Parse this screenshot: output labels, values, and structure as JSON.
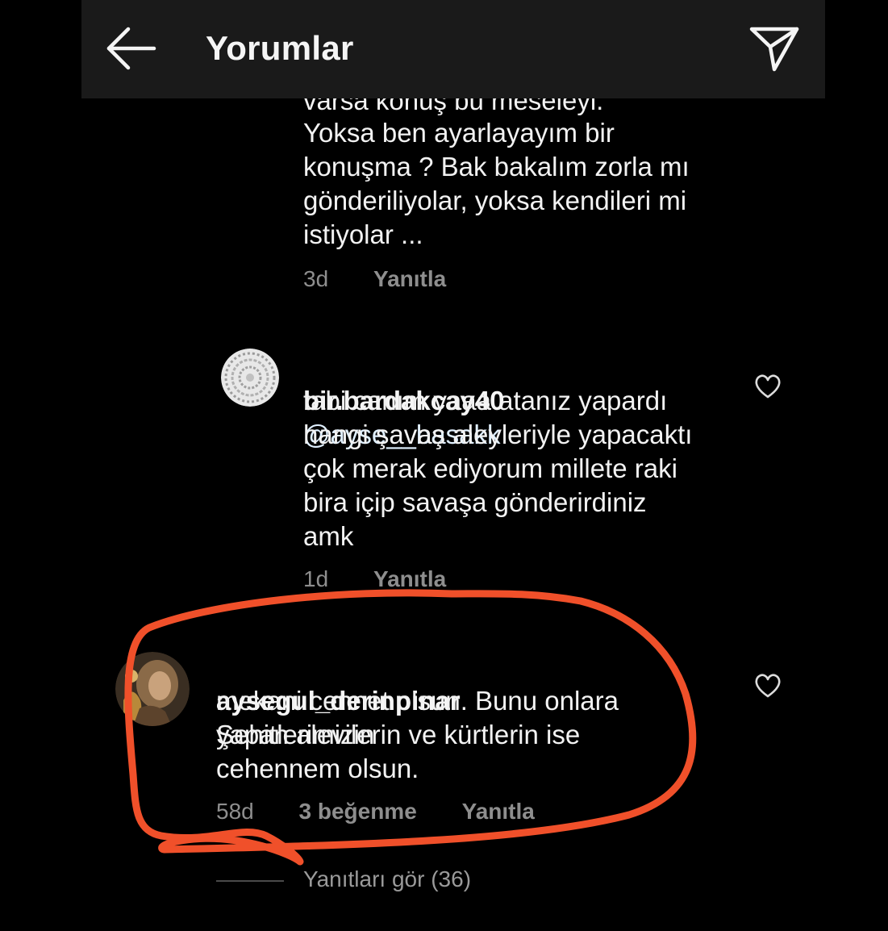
{
  "header": {
    "title": "Yorumlar",
    "back_icon": "arrow-left-icon",
    "send_icon": "paper-plane-icon"
  },
  "comments": [
    {
      "text_partial_top": "varsa konuş bu meseleyi.",
      "text": "Yoksa ben ayarlayayım bir\nkonuşma ? Bak bakalım zorla mı\ngönderiliyolar, yoksa kendileri mi\nistiyolar ...",
      "time": "3d",
      "reply_label": "Yanıtla"
    },
    {
      "username": "bir.bardakcay40",
      "mention": "@ayse__basakk",
      "text": "tabi canım yaaa atanız yapardı\nhangi şavaş aleyleriyle yapacaktı\nçok merak ediyorum millete raki\nbira içip savaşa gönderirdiniz\namk",
      "time": "1d",
      "reply_label": "Yanıtla"
    },
    {
      "username": "aysegul_derinpinar",
      "first_line": "Şehitlerimizin",
      "text": "mekani cennet olsun. Bunu onlara\nyapan alevilerin ve kürtlerin ise\ncehennem olsun.",
      "time": "58d",
      "likes": "3 beğenme",
      "reply_label": "Yanıtla",
      "view_replies": "Yanıtları gör (36)"
    }
  ],
  "colors": {
    "background": "#000000",
    "header": "#1a1a1a",
    "meta_text": "#8e8e8e",
    "annotation": "#f0502a"
  }
}
